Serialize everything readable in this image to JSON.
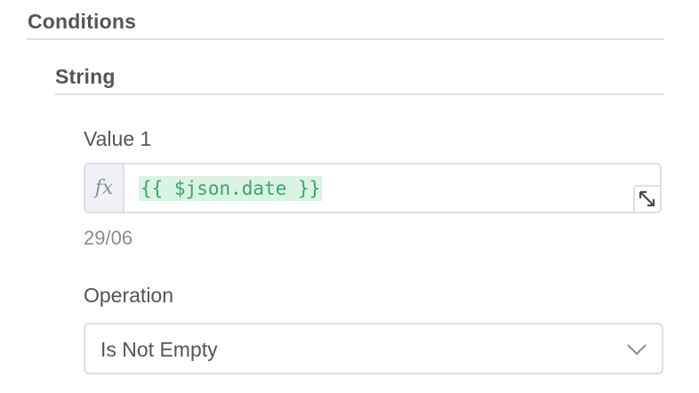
{
  "conditions": {
    "title": "Conditions"
  },
  "string_group": {
    "title": "String",
    "value1": {
      "label": "Value 1",
      "fx_label": "fx",
      "expression": "{{ $json.date }}",
      "preview": "29/06"
    },
    "operation": {
      "label": "Operation",
      "selected": "Is Not Empty"
    }
  },
  "icons": {
    "expand": "expand-diagonal-icon",
    "dropdown": "chevron-down-icon"
  },
  "colors": {
    "expression_text": "#3aa56d",
    "expression_bg": "#d9f3e4",
    "border": "#dbdfe7",
    "text": "#555555"
  }
}
